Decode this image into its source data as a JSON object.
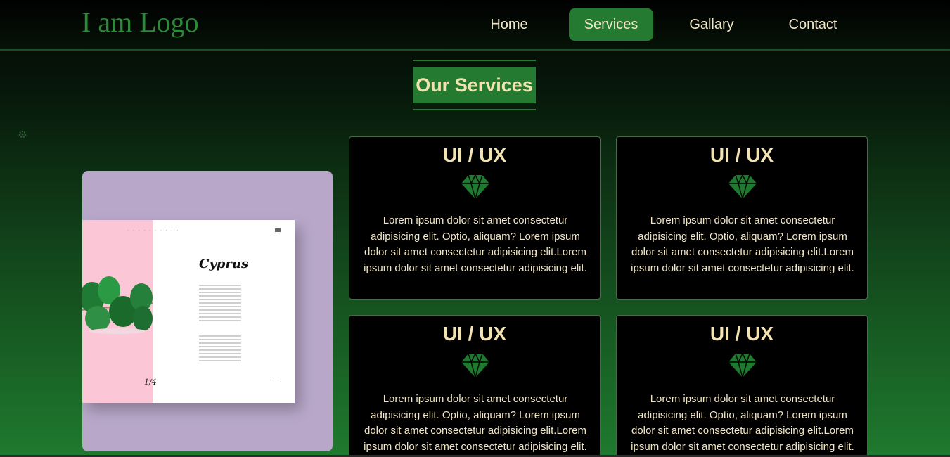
{
  "header": {
    "logo": "I am Logo",
    "nav": [
      {
        "label": "Home",
        "active": false
      },
      {
        "label": "Services",
        "active": true
      },
      {
        "label": "Gallary",
        "active": false
      },
      {
        "label": "Contact",
        "active": false
      }
    ]
  },
  "section": {
    "title": "Our Services"
  },
  "mockup": {
    "heading": "Cyprus",
    "page_number": "1/4"
  },
  "services": [
    {
      "title": "UI / UX",
      "icon": "diamond-icon",
      "text": "Lorem ipsum dolor sit amet consectetur adipisicing elit. Optio, aliquam? Lorem ipsum dolor sit amet consectetur adipisicing elit.Lorem ipsum dolor sit amet consectetur adipisicing elit."
    },
    {
      "title": "UI / UX",
      "icon": "diamond-icon",
      "text": "Lorem ipsum dolor sit amet consectetur adipisicing elit. Optio, aliquam? Lorem ipsum dolor sit amet consectetur adipisicing elit.Lorem ipsum dolor sit amet consectetur adipisicing elit."
    },
    {
      "title": "UI / UX",
      "icon": "diamond-icon",
      "text": "Lorem ipsum dolor sit amet consectetur adipisicing elit. Optio, aliquam? Lorem ipsum dolor sit amet consectetur adipisicing elit.Lorem ipsum dolor sit amet consectetur adipisicing elit."
    },
    {
      "title": "UI / UX",
      "icon": "diamond-icon",
      "text": "Lorem ipsum dolor sit amet consectetur adipisicing elit. Optio, aliquam? Lorem ipsum dolor sit amet consectetur adipisicing elit.Lorem ipsum dolor sit amet consectetur adipisicing elit."
    }
  ],
  "colors": {
    "accent": "#237a30",
    "logo": "#2c8a38",
    "title_text": "#f3e3b0",
    "card_bg": "#000000",
    "mockup_bg": "#b8a7c9",
    "mockup_pink": "#fbc6d6"
  }
}
